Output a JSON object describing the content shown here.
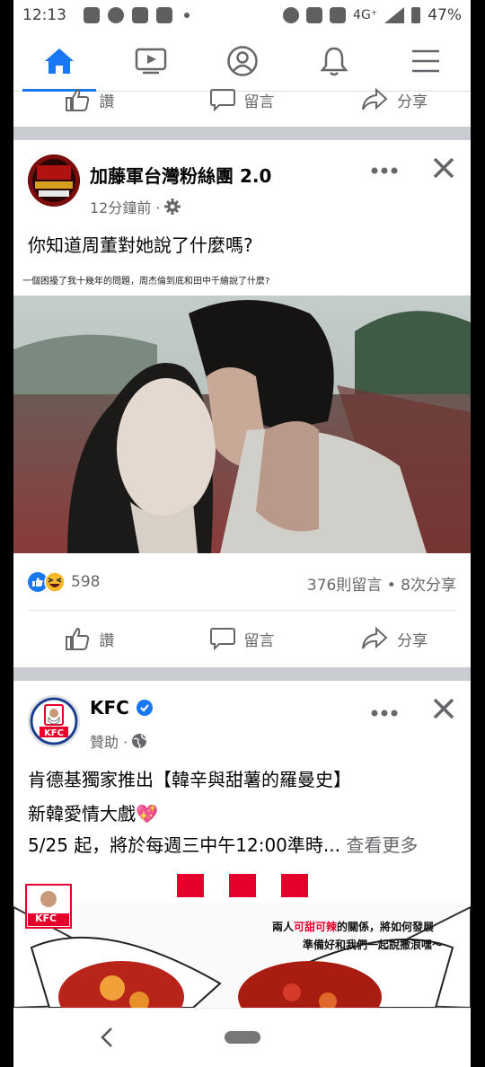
{
  "status_bar": {
    "time": "12:13",
    "network": "4G⁺",
    "battery": "47%"
  },
  "nav": {
    "tabs": [
      "home-icon",
      "watch-icon",
      "profile-icon",
      "notifications-icon",
      "menu-icon"
    ],
    "active": "home"
  },
  "top_actions": {
    "like": "讚",
    "comment": "留言",
    "share": "分享"
  },
  "post1": {
    "page_name": "加藤軍台灣粉絲團 2.0",
    "time": "12分鐘前 ·",
    "avatar_logo_text": "加藤軍 台灣粉絲團2.0 KATO ARMY",
    "text": "你知道周董對她說了什麼嗎?",
    "image_caption": "一個困擾了我十幾年的問題，周杰倫到底和田中千繪說了什麼?",
    "reaction_count": "598",
    "counts": "376則留言 • 8次分享",
    "actions": {
      "like": "讚",
      "comment": "留言",
      "share": "分享"
    }
  },
  "post2": {
    "page_name": "KFC",
    "meta": "贊助 ·",
    "line1": "肯德基獨家推出【韓辛與甜薯的羅曼史】",
    "line2": "新韓愛情大戲💖",
    "line3": "5/25 起，將於每週三中午12:00準時...",
    "see_more": "查看更多",
    "kfc_logo_text": "KFC",
    "banner_line1_a": "兩人",
    "banner_line1_b": "可甜可辣",
    "banner_line1_c": "的關係，將如何發展",
    "banner_line2": "準備好和我們一起說撒浪嘿～"
  },
  "colors": {
    "facebook_blue": "#1877f2",
    "divider": "#c9ccd1",
    "kfc_red": "#e4002b"
  }
}
